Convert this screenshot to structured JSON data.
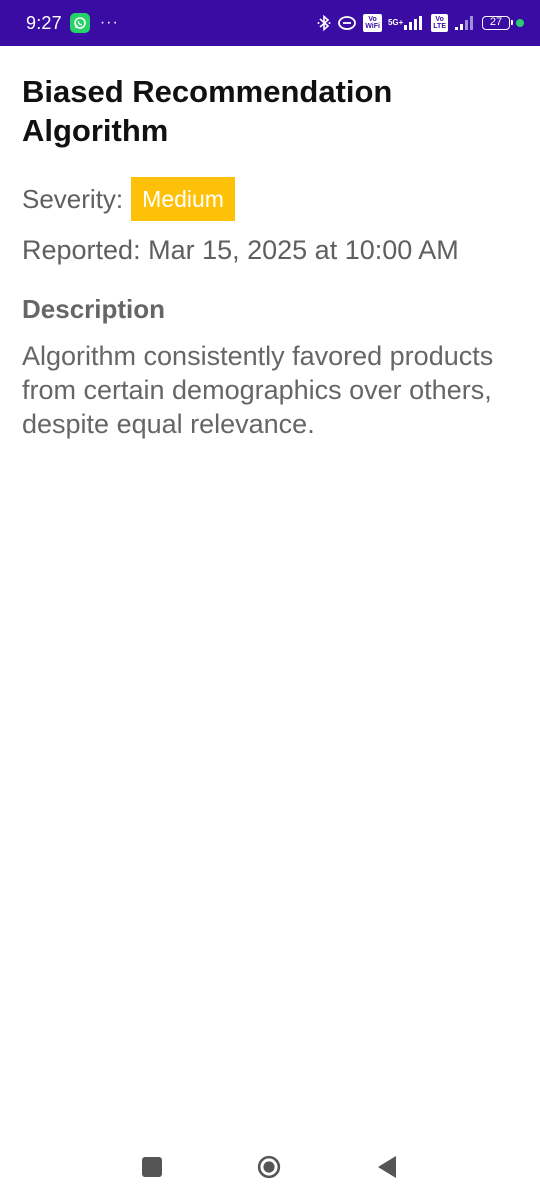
{
  "status_bar": {
    "time": "9:27",
    "more_indicator": "···",
    "network_5g": "5G+",
    "volte_label_1": "Vo\nWiFi",
    "volte_label_2": "Vo\nLTE",
    "battery_level": "27",
    "icons": [
      "whatsapp-icon",
      "bluetooth-icon",
      "link-icon",
      "signal-icon",
      "battery-icon"
    ],
    "background_color": "#3a0ca3"
  },
  "page": {
    "title": "Biased Recommendation Algorithm",
    "severity_label": "Severity:",
    "severity_value": "Medium",
    "severity_color": "#ffc107",
    "reported": "Reported: Mar 15, 2025 at 10:00 AM",
    "description_heading": "Description",
    "description_text": "Algorithm consistently favored products from certain demographics over others, despite equal relevance."
  },
  "nav_bar": {
    "icons": [
      "recents-square-icon",
      "home-circle-icon",
      "back-triangle-icon"
    ]
  }
}
